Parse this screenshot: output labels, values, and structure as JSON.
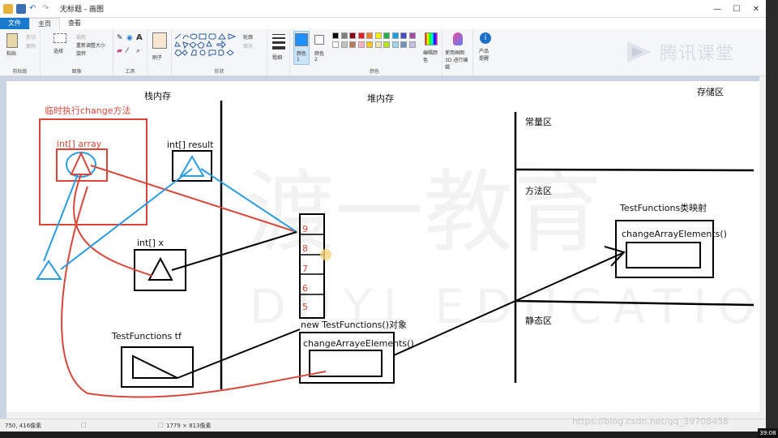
{
  "window": {
    "title": "无标题 - 画图",
    "minimize": "—",
    "maximize": "☐",
    "close": "✕"
  },
  "tabs": [
    {
      "label": "文件"
    },
    {
      "label": "主页"
    },
    {
      "label": "查看"
    }
  ],
  "ribbon": {
    "clipboard": {
      "paste": "粘贴",
      "cut": "剪切",
      "copy": "复制",
      "label": "剪贴板"
    },
    "image": {
      "select": "选择",
      "crop": "裁剪",
      "resize": "重新调整大小",
      "rotate": "旋转",
      "label": "图像"
    },
    "tools": {
      "label": "工具"
    },
    "brushes": {
      "label": "刷子"
    },
    "shapes": {
      "outline": "轮廓",
      "fill": "填充",
      "label": "形状"
    },
    "size": {
      "label": "粗细"
    },
    "color1": {
      "label": "颜色 1"
    },
    "color2": {
      "label": "颜色 2"
    },
    "colors": {
      "label": "颜色"
    },
    "edit_colors": {
      "label": "编辑颜色"
    },
    "paint3d": {
      "label": "使用画图 3D 进行编辑"
    },
    "product_alert": {
      "label": "产品提醒"
    },
    "palette": [
      "#000000",
      "#7f7f7f",
      "#880015",
      "#ed1c24",
      "#ff7f27",
      "#fff200",
      "#22b14c",
      "#00a2e8",
      "#3f48cc",
      "#a349a4",
      "#ffffff",
      "#c3c3c3",
      "#b97a57",
      "#ffaec9",
      "#ffc90e",
      "#efe4b0",
      "#b5e61d",
      "#99d9ea",
      "#7092be",
      "#c8bfe7"
    ],
    "color1_value": "#1e90ff",
    "color2_value": "#ffffff"
  },
  "logo": {
    "text": "腾讯课堂"
  },
  "diagram": {
    "stack_title": "栈内存",
    "heap_title": "堆内存",
    "storage_title": "存储区",
    "temp_method": "临时执行change方法",
    "array_var": "int[] array",
    "result_var": "int[] result",
    "x_var": "int[]    x",
    "tf_var": "TestFunctions    tf",
    "const_area": "常量区",
    "method_area": "方法区",
    "static_area": "静态区",
    "class_mapping": "TestFunctions类映射",
    "class_method": "changeArrayElements()",
    "new_object": "new TestFunctions()对象",
    "object_method": "changeArrayeElements()",
    "array_values": [
      "9",
      "8",
      "7",
      "6",
      "5"
    ],
    "watermark_big": "渡一教育",
    "watermark_small": "DUYI EDUCATION"
  },
  "status": {
    "cursor": "750, 416像素",
    "size": "1779 × 813像素"
  },
  "side": {
    "time": "39:08"
  },
  "csdn": "https://blog.csdn.net/qq_39708458"
}
